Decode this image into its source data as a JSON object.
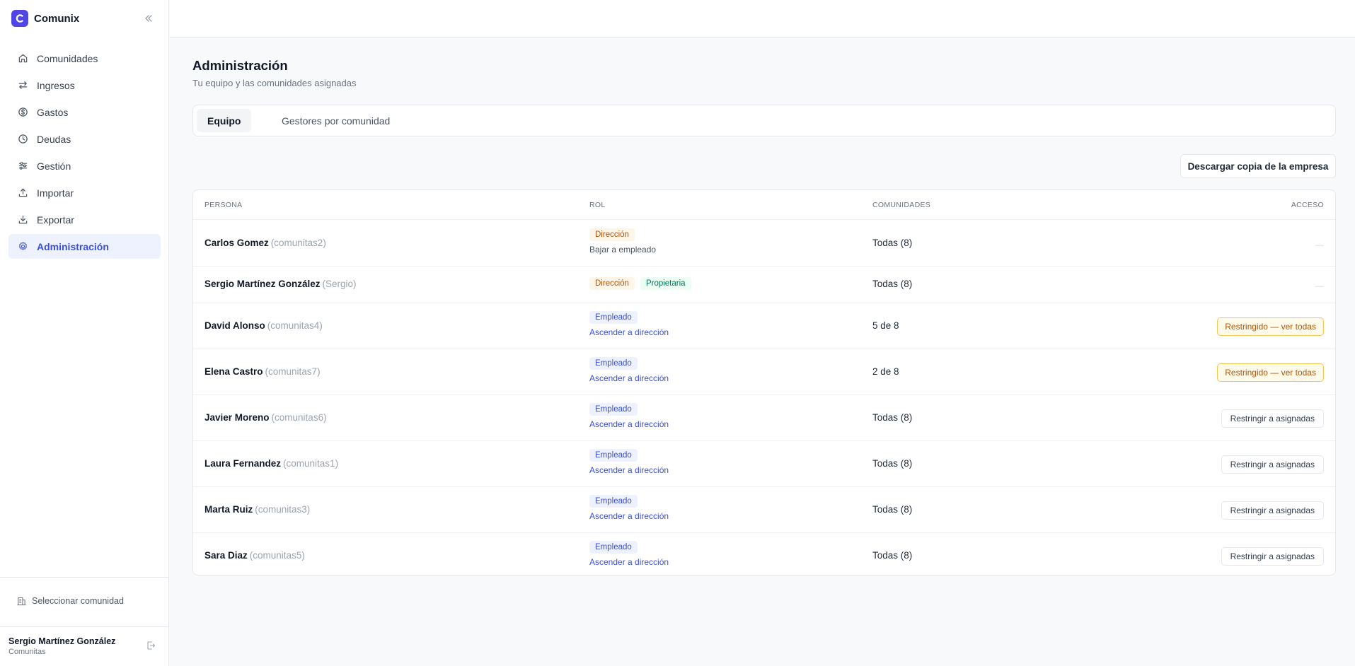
{
  "app": {
    "name": "Comunix",
    "brand_color": "#4f46e5",
    "accent_color": "#3b4fd8"
  },
  "sidebar": {
    "items": [
      {
        "label": "Comunidades",
        "icon": "home-icon"
      },
      {
        "label": "Ingresos",
        "icon": "arrows-left-right-icon"
      },
      {
        "label": "Gastos",
        "icon": "dollar-circle-icon"
      },
      {
        "label": "Deudas",
        "icon": "clock-icon"
      },
      {
        "label": "Gestión",
        "icon": "sliders-icon"
      },
      {
        "label": "Importar",
        "icon": "upload-icon"
      },
      {
        "label": "Exportar",
        "icon": "download-icon"
      },
      {
        "label": "Administración",
        "icon": "gear-icon",
        "active": true
      }
    ],
    "select_community": "Seleccionar comunidad",
    "user": {
      "name": "Sergio Martínez González",
      "org": "Comunitas"
    }
  },
  "main": {
    "title": "Administración",
    "subtitle": "Tu equipo y las comunidades asignadas",
    "tabs": [
      {
        "label": "Equipo",
        "active": true
      },
      {
        "label": "Gestores por comunidad",
        "active": false
      }
    ],
    "download_label": "Descargar copia de la empresa",
    "table": {
      "headers": {
        "persona": "Persona",
        "rol": "Rol",
        "comunidades": "Comunidades",
        "acceso": "Acceso"
      },
      "rows": [
        {
          "name": "Carlos Gomez",
          "username": "(comunitas2)",
          "badges": [
            {
              "text": "Dirección",
              "kind": "dir"
            }
          ],
          "role_action": "Bajar a empleado",
          "role_action_kind": "demote",
          "communities": "Todas (8)",
          "access": "—",
          "access_kind": "none"
        },
        {
          "name": "Sergio Martínez González",
          "username": "(Sergio)",
          "badges": [
            {
              "text": "Dirección",
              "kind": "dir"
            },
            {
              "text": "Propietaria",
              "kind": "prop"
            }
          ],
          "role_action": "",
          "role_action_kind": "",
          "communities": "Todas (8)",
          "access": "—",
          "access_kind": "none"
        },
        {
          "name": "David Alonso",
          "username": "(comunitas4)",
          "badges": [
            {
              "text": "Empleado",
              "kind": "emp"
            }
          ],
          "role_action": "Ascender a dirección",
          "role_action_kind": "promote",
          "communities": "5 de 8",
          "access": "Restringido — ver todas",
          "access_kind": "restricted"
        },
        {
          "name": "Elena Castro",
          "username": "(comunitas7)",
          "badges": [
            {
              "text": "Empleado",
              "kind": "emp"
            }
          ],
          "role_action": "Ascender a dirección",
          "role_action_kind": "promote",
          "communities": "2 de 8",
          "access": "Restringido — ver todas",
          "access_kind": "restricted"
        },
        {
          "name": "Javier Moreno",
          "username": "(comunitas6)",
          "badges": [
            {
              "text": "Empleado",
              "kind": "emp"
            }
          ],
          "role_action": "Ascender a dirección",
          "role_action_kind": "promote",
          "communities": "Todas (8)",
          "access": "Restringir a asignadas",
          "access_kind": "restrict"
        },
        {
          "name": "Laura Fernandez",
          "username": "(comunitas1)",
          "badges": [
            {
              "text": "Empleado",
              "kind": "emp"
            }
          ],
          "role_action": "Ascender a dirección",
          "role_action_kind": "promote",
          "communities": "Todas (8)",
          "access": "Restringir a asignadas",
          "access_kind": "restrict"
        },
        {
          "name": "Marta Ruiz",
          "username": "(comunitas3)",
          "badges": [
            {
              "text": "Empleado",
              "kind": "emp"
            }
          ],
          "role_action": "Ascender a dirección",
          "role_action_kind": "promote",
          "communities": "Todas (8)",
          "access": "Restringir a asignadas",
          "access_kind": "restrict"
        },
        {
          "name": "Sara Diaz",
          "username": "(comunitas5)",
          "badges": [
            {
              "text": "Empleado",
              "kind": "emp"
            }
          ],
          "role_action": "Ascender a dirección",
          "role_action_kind": "promote",
          "communities": "Todas (8)",
          "access": "Restringir a asignadas",
          "access_kind": "restrict"
        }
      ]
    }
  }
}
